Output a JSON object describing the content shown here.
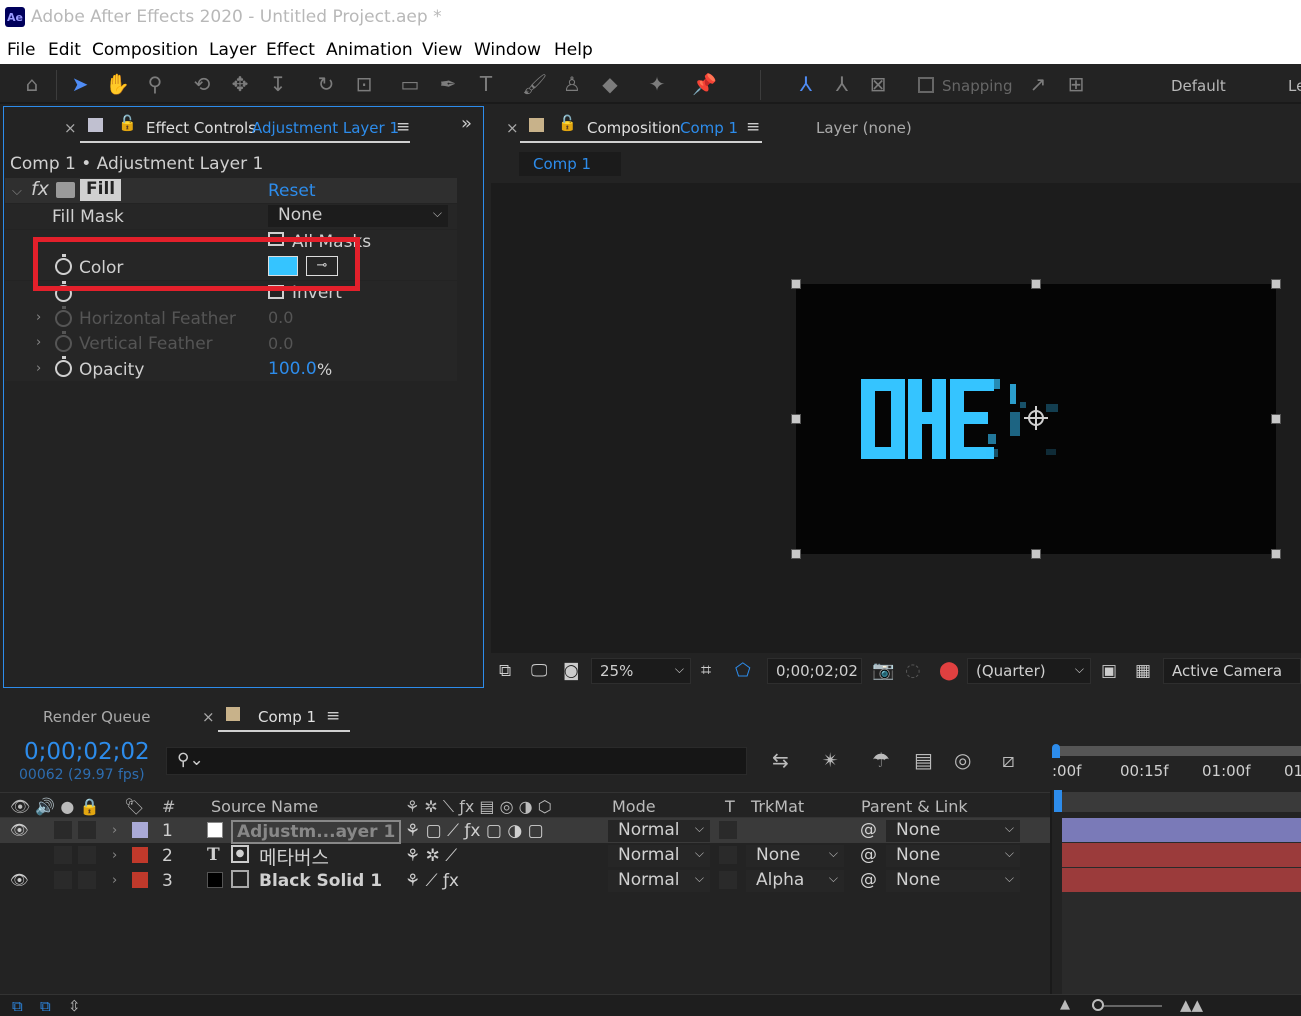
{
  "titlebar": {
    "app_icon": "Ae",
    "title": "Adobe After Effects 2020 - Untitled Project.aep *"
  },
  "menu": [
    "File",
    "Edit",
    "Composition",
    "Layer",
    "Effect",
    "Animation",
    "View",
    "Window",
    "Help"
  ],
  "toolbar": {
    "snapping_label": "Snapping",
    "workspace_default": "Default",
    "workspace_next": "Le"
  },
  "effect_controls": {
    "tab_label": "Effect Controls",
    "tab_layer": "Adjustment Layer 1",
    "breadcrumb": "Comp 1 • Adjustment Layer 1",
    "effect_name": "Fill",
    "fx_label": "fx",
    "reset_label": "Reset",
    "fill_mask_label": "Fill Mask",
    "fill_mask_value": "None",
    "all_masks_label": "All Masks",
    "color_label": "Color",
    "color_value": "#35c4ff",
    "invert_label": "Invert",
    "horizontal_feather_label": "Horizontal Feather",
    "horizontal_feather_value": "0.0",
    "vertical_feather_label": "Vertical Feather",
    "vertical_feather_value": "0.0",
    "opacity_label": "Opacity",
    "opacity_value": "100.0",
    "opacity_unit": "%"
  },
  "composition": {
    "tab_label": "Composition",
    "tab_comp": "Comp 1",
    "layer_tab": "Layer (none)",
    "comp_subtab": "Comp 1",
    "zoom": "25%",
    "timecode": "0;00;02;02",
    "resolution": "(Quarter)",
    "camera": "Active Camera",
    "text_color": "#35c4ff"
  },
  "timeline": {
    "render_queue_tab": "Render Queue",
    "comp_tab": "Comp 1",
    "timecode": "0;00;02;02",
    "frames": "00062 (29.97 fps)",
    "ruler": [
      ":00f",
      "00:15f",
      "01:00f",
      "01"
    ],
    "columns": {
      "num": "#",
      "source": "Source Name",
      "mode": "Mode",
      "t": "T",
      "trkmat": "TrkMat",
      "parent": "Parent & Link"
    },
    "layers": [
      {
        "num": "1",
        "name": "Adjustm...ayer 1",
        "mode": "Normal",
        "trkmat": "",
        "parent": "None",
        "label_color": "#a9a9d6",
        "swatch": "#ffffff",
        "bar_color": "#7a7ab8"
      },
      {
        "num": "2",
        "name": "메타버스",
        "mode": "Normal",
        "trkmat": "None",
        "parent": "None",
        "label_color": "#c0392b",
        "swatch": "",
        "bar_color": "#9b3b3b"
      },
      {
        "num": "3",
        "name": "Black Solid 1",
        "mode": "Normal",
        "trkmat": "Alpha",
        "parent": "None",
        "label_color": "#c0392b",
        "swatch": "#000000",
        "bar_color": "#9b3b3b"
      }
    ]
  },
  "highlight": {
    "color": "#e3202b"
  }
}
